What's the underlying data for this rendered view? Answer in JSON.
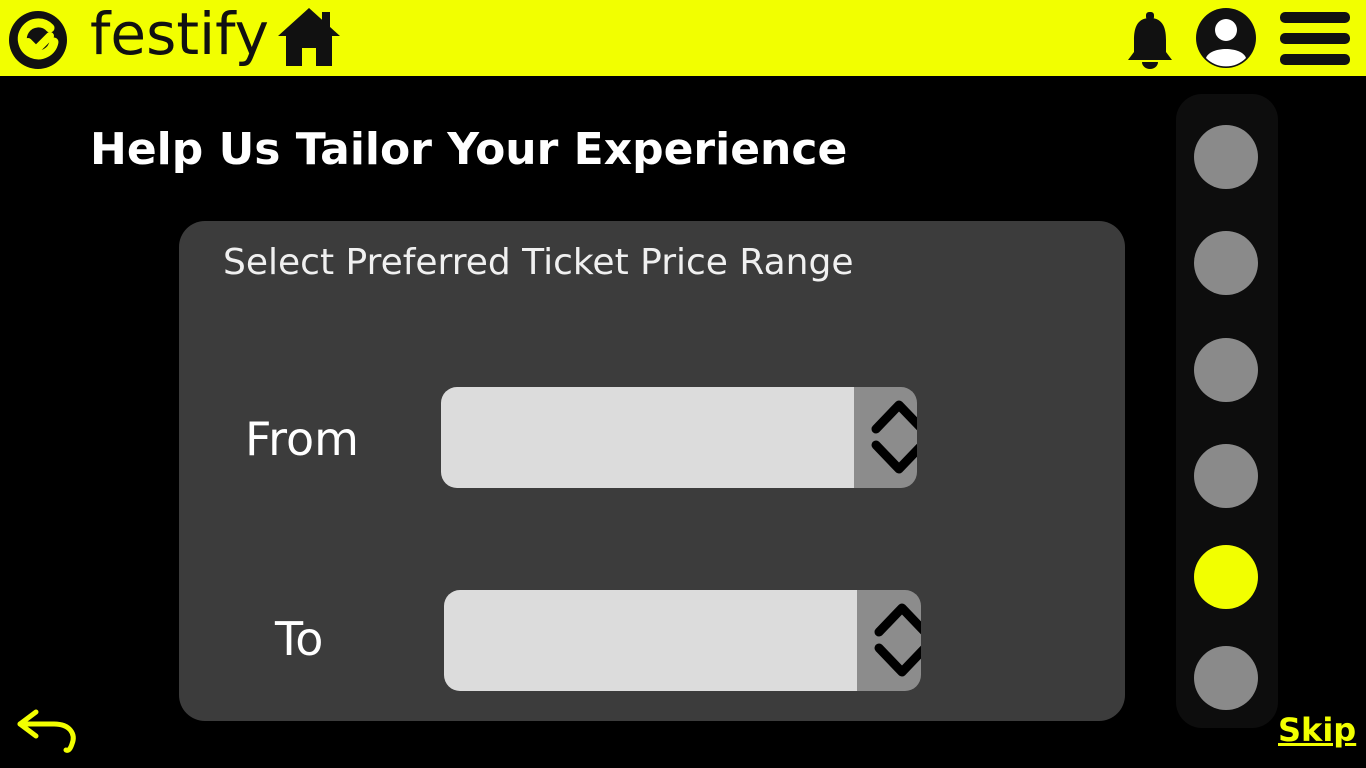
{
  "app": {
    "brand": "festify",
    "accent_color": "#f2ff00",
    "icons": [
      "logo-icon",
      "home-icon",
      "bell-icon",
      "user-icon",
      "menu-icon",
      "back-arrow-icon"
    ]
  },
  "page": {
    "title": "Help Us Tailor Your Experience"
  },
  "price_range": {
    "heading": "Select Preferred Ticket Price Range",
    "from": {
      "label": "From",
      "value": ""
    },
    "to": {
      "label": "To",
      "value": ""
    }
  },
  "progress": {
    "total_steps": 6,
    "current_step": 5
  },
  "footer": {
    "skip_label": "Skip"
  }
}
